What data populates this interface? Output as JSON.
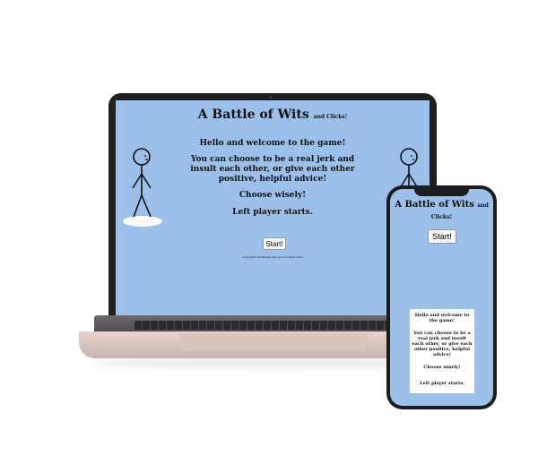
{
  "game": {
    "title": "A Battle of Wits",
    "title_suffix": "and Clicks!",
    "welcome": "Hello and welcome to the game!",
    "description": "You can choose to be a real jerk and insult each other, or give each other positive, helpful advice!",
    "choose": "Choose wisely!",
    "starts": "Left player starts.",
    "start_button": "Start!",
    "copyright": "Copyright Christiaan and Joost College 2022"
  },
  "colors": {
    "screen_bg": "#9dc0ea",
    "laptop_body": "#1f1f22",
    "laptop_base": "#e8d3ce",
    "phone_body": "#1c1c1f"
  },
  "figures": [
    "stick-figure-left",
    "stick-figure-right"
  ]
}
